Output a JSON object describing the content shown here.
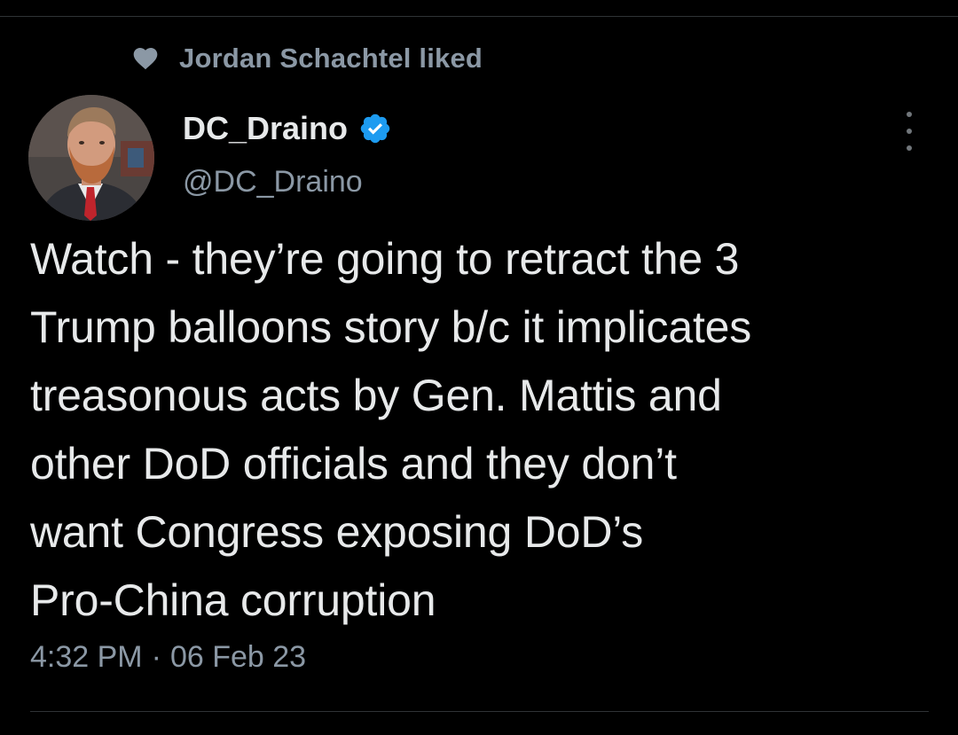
{
  "social_context": {
    "text": "Jordan Schachtel liked",
    "icon": "heart-icon"
  },
  "author": {
    "display_name": "DC_Draino",
    "handle": "@DC_Draino",
    "verified": true,
    "verified_color": "#1d9bf0"
  },
  "tweet": {
    "text": "Watch - they’re going to retract the 3\nTrump balloons story b/c it implicates\ntreasonous acts by Gen. Mattis and\nother DoD officials and they don’t\nwant Congress exposing DoD’s\nPro-China corruption",
    "time": "4:32 PM",
    "separator": "·",
    "date": "06 Feb 23"
  },
  "colors": {
    "background": "#000000",
    "primary_text": "#e7e9ea",
    "secondary_text": "#8b98a5",
    "divider": "#2f3336"
  }
}
